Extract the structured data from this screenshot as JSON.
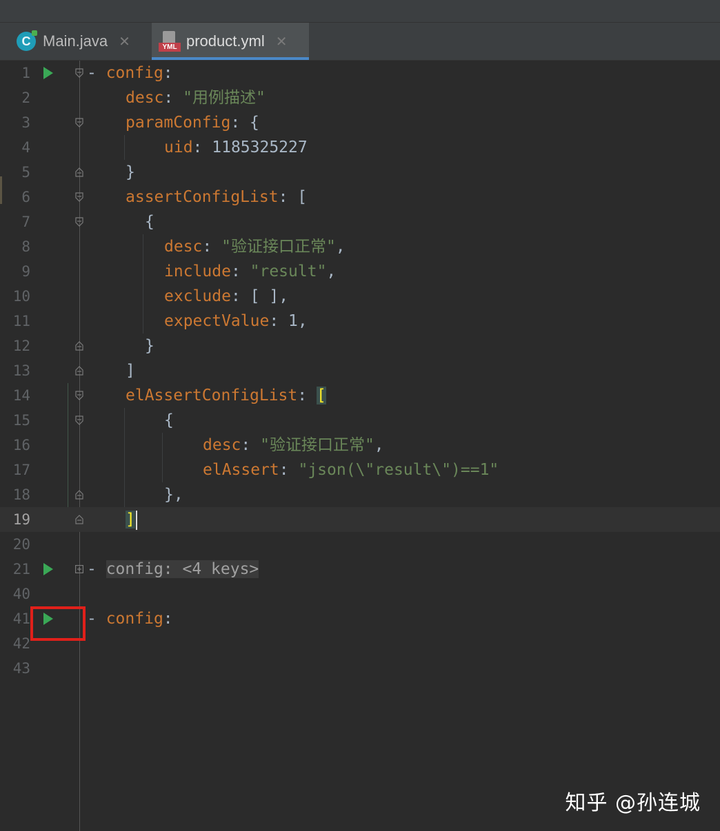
{
  "tabs": [
    {
      "label": "Main.java",
      "icon": "java-class-icon",
      "active": false
    },
    {
      "label": "product.yml",
      "icon": "yml-file-icon",
      "active": true
    }
  ],
  "editor": {
    "current_line": "19",
    "lines": [
      {
        "num": "1"
      },
      {
        "num": "2"
      },
      {
        "num": "3"
      },
      {
        "num": "4"
      },
      {
        "num": "5"
      },
      {
        "num": "6"
      },
      {
        "num": "7"
      },
      {
        "num": "8"
      },
      {
        "num": "9"
      },
      {
        "num": "10"
      },
      {
        "num": "11"
      },
      {
        "num": "12"
      },
      {
        "num": "13"
      },
      {
        "num": "14"
      },
      {
        "num": "15"
      },
      {
        "num": "16"
      },
      {
        "num": "17"
      },
      {
        "num": "18"
      },
      {
        "num": "19"
      },
      {
        "num": "20"
      },
      {
        "num": "21"
      },
      {
        "num": "40"
      },
      {
        "num": "41"
      },
      {
        "num": "42"
      },
      {
        "num": "43"
      }
    ],
    "tokens": {
      "dash": "- ",
      "config": "config",
      "colon": ":",
      "colon_sp": ": ",
      "desc": "desc",
      "desc_val": "\"用例描述\"",
      "paramConfig": "paramConfig",
      "open_brace": "{",
      "close_brace": "}",
      "uid": "uid",
      "uid_val": "1185325227",
      "assertConfigList": "assertConfigList",
      "open_bracket": "[",
      "close_bracket": "]",
      "desc_val2": "\"验证接口正常\"",
      "comma": ",",
      "include": "include",
      "include_val": "\"result\"",
      "exclude": "exclude",
      "exclude_val": "[ ]",
      "expectValue": "expectValue",
      "expect_val": "1",
      "elAssertConfigList": "elAssertConfigList",
      "elAssert": "elAssert",
      "elAssert_val": "\"json(\\\"result\\\")==1\"",
      "close_brace_comma": "},",
      "collapsed_placeholder": "config: <4 keys>"
    }
  },
  "watermark": "知乎 @孙连城",
  "colors": {
    "background": "#2b2b2b",
    "keyword": "#cc7832",
    "string": "#6a8759",
    "text": "#a9b7c6",
    "run_icon": "#3aa856",
    "highlight_box": "#e0201a",
    "active_tab_underline": "#4a88c7"
  }
}
